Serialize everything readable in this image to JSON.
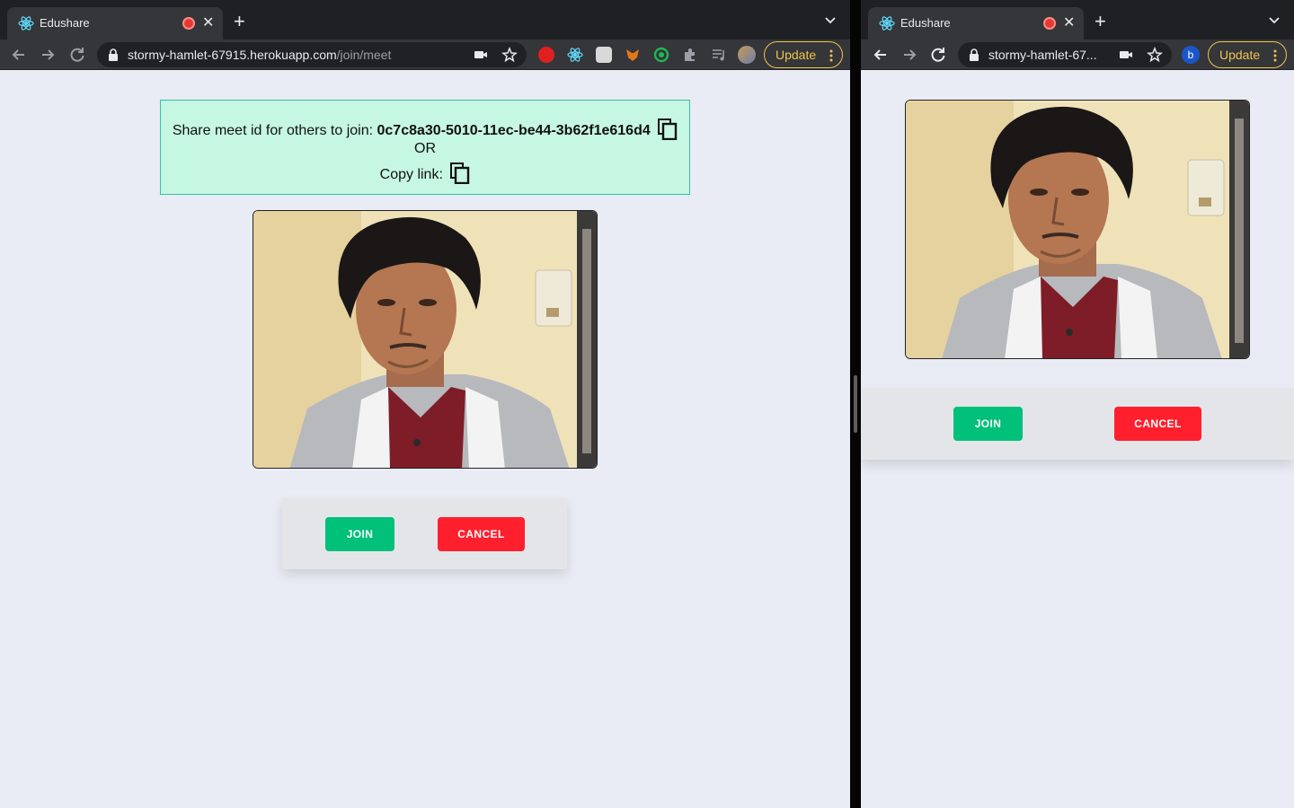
{
  "left_window": {
    "tab": {
      "title": "Edushare"
    },
    "address": {
      "host": "stormy-hamlet-67915.herokuapp.com",
      "path": "/join/meet"
    },
    "update_label": "Update",
    "share": {
      "prefix": "Share meet id for others to join:",
      "meet_id": "0c7c8a30-5010-11ec-be44-3b62f1e616d4",
      "or_text": "OR",
      "copy_link_label": "Copy link:"
    },
    "controls": {
      "join_label": "JOIN",
      "cancel_label": "CANCEL"
    }
  },
  "right_window": {
    "tab": {
      "title": "Edushare"
    },
    "address": {
      "host": "stormy-hamlet-67..."
    },
    "avatar_letter": "b",
    "update_label": "Update",
    "controls": {
      "join_label": "JOIN",
      "cancel_label": "CANCEL"
    }
  },
  "colors": {
    "join": "#00c07a",
    "cancel": "#ff1f2d",
    "share_bg": "#c6f7e2",
    "page_bg": "#e9ecf4",
    "update": "#f0c34a"
  }
}
